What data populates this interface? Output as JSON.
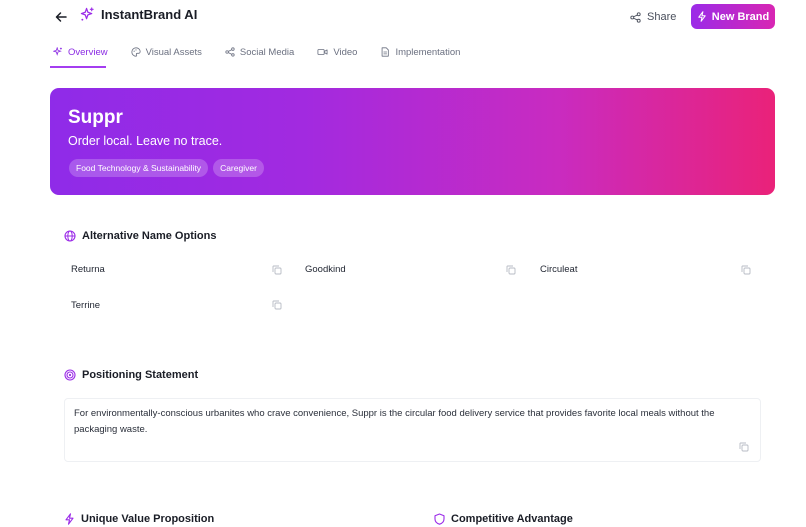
{
  "header": {
    "title": "InstantBrand AI",
    "share_label": "Share",
    "new_brand_label": "New Brand"
  },
  "tabs": [
    {
      "label": "Overview",
      "icon": "sparkle-icon",
      "active": true
    },
    {
      "label": "Visual Assets",
      "icon": "palette-icon",
      "active": false
    },
    {
      "label": "Social Media",
      "icon": "share-icon",
      "active": false
    },
    {
      "label": "Video",
      "icon": "video-icon",
      "active": false
    },
    {
      "label": "Implementation",
      "icon": "document-icon",
      "active": false
    }
  ],
  "hero": {
    "name": "Suppr",
    "tagline": "Order local. Leave no trace.",
    "tags": [
      "Food Technology & Sustainability",
      "Caregiver"
    ]
  },
  "alternative_names": {
    "title": "Alternative Name Options",
    "items": [
      "Returna",
      "Goodkind",
      "Circuleat",
      "Terrine"
    ]
  },
  "positioning": {
    "title": "Positioning Statement",
    "text": "For environmentally-conscious urbanites who crave convenience, Suppr is the circular food delivery service that provides favorite local meals without the packaging waste."
  },
  "value_proposition": {
    "title": "Unique Value Proposition"
  },
  "competitive_advantage": {
    "title": "Competitive Advantage"
  },
  "colors": {
    "accent": "#9b2be8",
    "gradient_start": "#8f2be8",
    "gradient_end": "#ea2279"
  }
}
